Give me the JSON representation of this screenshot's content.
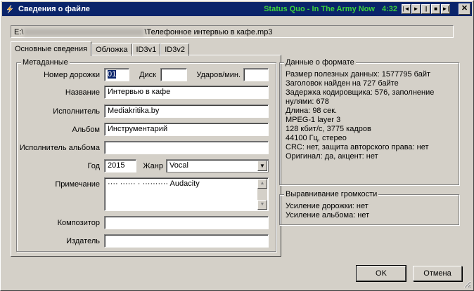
{
  "window": {
    "title": "Сведения о файле",
    "now_playing": "Status Quo - In The Army Now",
    "time": "4:32",
    "player_buttons": [
      "|◄",
      "►",
      "||",
      "■",
      "►|"
    ],
    "close": "✕"
  },
  "path": {
    "prefix": "E:\\",
    "suffix": "\\Телефонное интервью в кафе.mp3"
  },
  "tabs": [
    "Основные сведения",
    "Обложка",
    "ID3v1",
    "ID3v2"
  ],
  "metadata": {
    "group_label": "Метаданные",
    "track_label": "Номер дорожки",
    "track_value": "01",
    "disc_label": "Диск",
    "disc_value": "",
    "bpm_label": "Ударов/мин.",
    "bpm_value": "",
    "title_label": "Название",
    "title_value": "Интервью в кафе",
    "artist_label": "Исполнитель",
    "artist_value": "Mediakritika.by",
    "album_label": "Альбом",
    "album_value": "Инструментарий",
    "album_artist_label": "Исполнитель альбома",
    "album_artist_value": "",
    "year_label": "Год",
    "year_value": "2015",
    "genre_label": "Жанр",
    "genre_value": "Vocal",
    "comment_label": "Примечание",
    "comment_value": "···· ······ · ·········· Audacity",
    "composer_label": "Композитор",
    "composer_value": "",
    "publisher_label": "Издатель",
    "publisher_value": ""
  },
  "format": {
    "group_label": "Данные о формате",
    "lines": [
      "Размер полезных данных: 1577795 байт",
      "Заголовок найден на 727 байте",
      "Задержка кодировщика: 576, заполнение",
      "нулями: 678",
      "Длина: 98 сек.",
      "MPEG-1 layer 3",
      "128 кбит/с, 3775 кадров",
      "44100 Гц, стерео",
      "CRC: нет, защита авторского права: нет",
      "Оригинал: да, акцент: нет"
    ]
  },
  "gain": {
    "group_label": "Выравнивание громкости",
    "lines": [
      "Усиление дорожки: нет",
      "Усиление альбома: нет"
    ]
  },
  "buttons": {
    "ok": "OK",
    "cancel": "Отмена"
  }
}
